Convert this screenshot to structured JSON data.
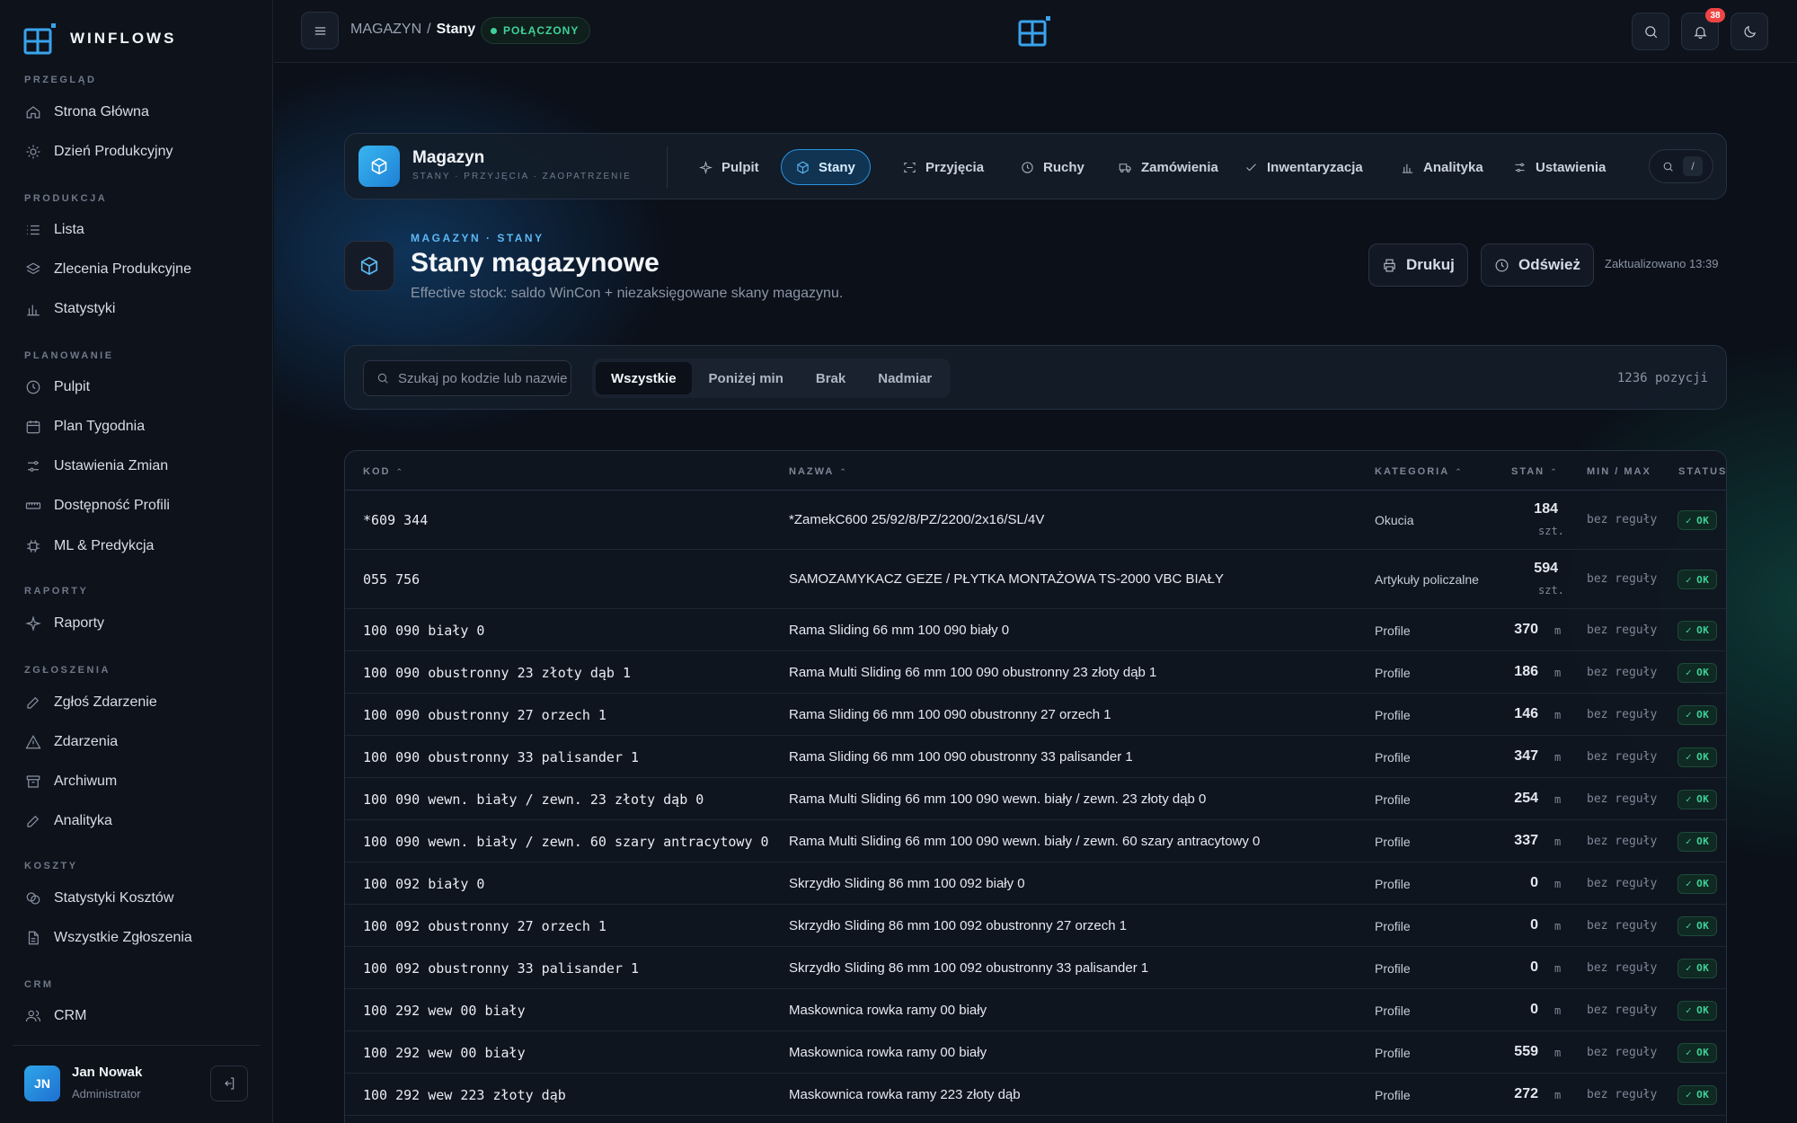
{
  "app": {
    "brand": "WINFLOWS"
  },
  "sidebar": {
    "sections": {
      "przeglad": "PRZEGLĄD",
      "produkcja": "PRODUKCJA",
      "planowanie": "PLANOWANIE",
      "raporty": "RAPORTY",
      "zgloszenia": "ZGŁOSZENIA",
      "koszty": "KOSZTY",
      "crm": "CRM"
    },
    "items": {
      "home": "Strona Główna",
      "production_day": "Dzień Produkcyjny",
      "list": "Lista",
      "orders": "Zlecenia Produkcyjne",
      "stats": "Statystyki",
      "dashboard": "Pulpit",
      "week_plan": "Plan Tygodnia",
      "shift_settings": "Ustawienia Zmian",
      "profile_availability": "Dostępność Profili",
      "ml": "ML & Predykcja",
      "reports": "Raporty",
      "report_incident": "Zgłoś Zdarzenie",
      "incidents": "Zdarzenia",
      "archive": "Archiwum",
      "analytics": "Analityka",
      "cost_stats": "Statystyki Kosztów",
      "all_reports": "Wszystkie Zgłoszenia",
      "crm": "CRM"
    },
    "user": {
      "initials": "JN",
      "name": "Jan Nowak",
      "role": "Administrator"
    }
  },
  "topbar": {
    "breadcrumb_root": "MAGAZYN",
    "breadcrumb_sep": "/",
    "breadcrumb_current": "Stany",
    "status": "POŁĄCZONY",
    "notifications_count": "38"
  },
  "module": {
    "title": "Magazyn",
    "subtitle": "STANY · PRZYJĘCIA · ZAOPATRZENIE",
    "tabs": {
      "pulpit": "Pulpit",
      "stany": "Stany",
      "przyjecia": "Przyjęcia",
      "ruchy": "Ruchy",
      "zamowienia": "Zamówienia",
      "inwentaryzacja": "Inwentaryzacja",
      "analityka": "Analityka",
      "ustawienia": "Ustawienia"
    },
    "search_shortcut": "/"
  },
  "page": {
    "kicker": "MAGAZYN · STANY",
    "title": "Stany magazynowe",
    "description": "Effective stock: saldo WinCon + niezaksięgowane skany magazynu.",
    "print_label": "Drukuj",
    "refresh_label": "Odśwież",
    "updated": "Zaktualizowano 13:39"
  },
  "filters": {
    "search_placeholder": "Szukaj po kodzie lub nazwie",
    "segments": [
      "Wszystkie",
      "Poniżej min",
      "Brak",
      "Nadmiar"
    ],
    "count": "1236 pozycji"
  },
  "table": {
    "headers": {
      "code": "KOD",
      "name": "NAZWA",
      "category": "KATEGORIA",
      "stock": "STAN",
      "minmax": "MIN / MAX",
      "status": "STATUS"
    },
    "rows": [
      {
        "code": "*609 344",
        "name": "*ZamekC600 25/92/8/PZ/2200/2x16/SL/4V",
        "category": "Okucia",
        "qty": "184",
        "unit": "szt.",
        "rule": "bez reguły",
        "status": "OK"
      },
      {
        "code": "055 756",
        "name": "SAMOZAMYKACZ GEZE / PŁYTKA MONTAŻOWA TS-2000 VBC BIAŁY",
        "category": "Artykuły policzalne",
        "qty": "594",
        "unit": "szt.",
        "rule": "bez reguły",
        "status": "OK"
      },
      {
        "code": "100 090 biały 0",
        "name": "Rama Sliding 66 mm 100 090 biały 0",
        "category": "Profile",
        "qty": "370",
        "unit": "m",
        "rule": "bez reguły",
        "status": "OK"
      },
      {
        "code": "100 090 obustronny 23 złoty dąb 1",
        "name": "Rama Multi Sliding 66 mm 100 090 obustronny 23 złoty dąb 1",
        "category": "Profile",
        "qty": "186",
        "unit": "m",
        "rule": "bez reguły",
        "status": "OK"
      },
      {
        "code": "100 090 obustronny 27 orzech 1",
        "name": "Rama Sliding 66 mm 100 090 obustronny 27 orzech 1",
        "category": "Profile",
        "qty": "146",
        "unit": "m",
        "rule": "bez reguły",
        "status": "OK"
      },
      {
        "code": "100 090 obustronny 33 palisander 1",
        "name": "Rama Sliding 66 mm 100 090 obustronny 33 palisander 1",
        "category": "Profile",
        "qty": "347",
        "unit": "m",
        "rule": "bez reguły",
        "status": "OK"
      },
      {
        "code": "100 090 wewn. biały / zewn. 23 złoty dąb 0",
        "name": "Rama Multi Sliding 66 mm 100 090 wewn. biały / zewn. 23 złoty dąb 0",
        "category": "Profile",
        "qty": "254",
        "unit": "m",
        "rule": "bez reguły",
        "status": "OK"
      },
      {
        "code": "100 090 wewn. biały / zewn. 60 szary antracytowy 0",
        "name": "Rama Multi Sliding 66 mm 100 090 wewn. biały / zewn. 60 szary antracytowy 0",
        "category": "Profile",
        "qty": "337",
        "unit": "m",
        "rule": "bez reguły",
        "status": "OK"
      },
      {
        "code": "100 092 biały 0",
        "name": "Skrzydło Sliding 86 mm 100 092 biały 0",
        "category": "Profile",
        "qty": "0",
        "unit": "m",
        "rule": "bez reguły",
        "status": "OK"
      },
      {
        "code": "100 092 obustronny 27 orzech 1",
        "name": "Skrzydło Sliding 86 mm 100 092 obustronny 27 orzech 1",
        "category": "Profile",
        "qty": "0",
        "unit": "m",
        "rule": "bez reguły",
        "status": "OK"
      },
      {
        "code": "100 092 obustronny 33 palisander 1",
        "name": "Skrzydło Sliding 86 mm 100 092 obustronny 33 palisander 1",
        "category": "Profile",
        "qty": "0",
        "unit": "m",
        "rule": "bez reguły",
        "status": "OK"
      },
      {
        "code": "100 292 wew 00 biały",
        "name": "Maskownica rowka ramy 00 biały",
        "category": "Profile",
        "qty": "0",
        "unit": "m",
        "rule": "bez reguły",
        "status": "OK"
      },
      {
        "code": "100 292 wew 00 biały",
        "name": "Maskownica rowka ramy 00 biały",
        "category": "Profile",
        "qty": "559",
        "unit": "m",
        "rule": "bez reguły",
        "status": "OK"
      },
      {
        "code": "100 292 wew 223 złoty dąb",
        "name": "Maskownica rowka ramy 223 złoty dąb",
        "category": "Profile",
        "qty": "272",
        "unit": "m",
        "rule": "bez reguły",
        "status": "OK"
      }
    ]
  }
}
